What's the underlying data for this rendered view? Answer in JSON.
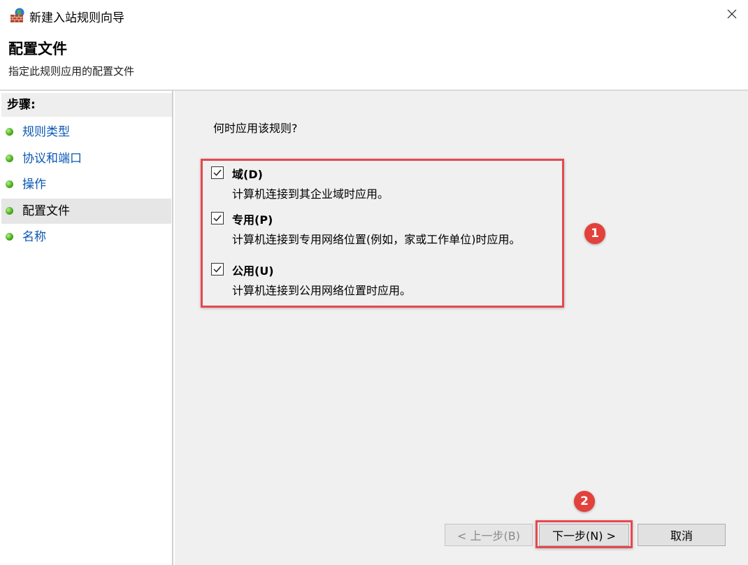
{
  "window": {
    "title": "新建入站规则向导"
  },
  "header": {
    "heading": "配置文件",
    "subheading": "指定此规则应用的配置文件"
  },
  "sidebar": {
    "heading": "步骤:",
    "items": [
      {
        "label": "规则类型"
      },
      {
        "label": "协议和端口"
      },
      {
        "label": "操作"
      },
      {
        "label": "配置文件",
        "active": true
      },
      {
        "label": "名称"
      }
    ]
  },
  "content": {
    "question": "何时应用该规则?",
    "options": [
      {
        "label": "域(D)",
        "description": "计算机连接到其企业域时应用。",
        "checked": true
      },
      {
        "label": "专用(P)",
        "description": "计算机连接到专用网络位置(例如，家或工作单位)时应用。",
        "checked": true
      },
      {
        "label": "公用(U)",
        "description": "计算机连接到公用网络位置时应用。",
        "checked": true
      }
    ]
  },
  "markers": {
    "first": "1",
    "second": "2"
  },
  "buttons": {
    "back": "< 上一步(B)",
    "next": "下一步(N) >",
    "cancel": "取消"
  },
  "colors": {
    "highlight": "#e5484f",
    "marker": "#e2413c",
    "link": "#0a57b3",
    "content_bg": "#f0f0f0"
  }
}
